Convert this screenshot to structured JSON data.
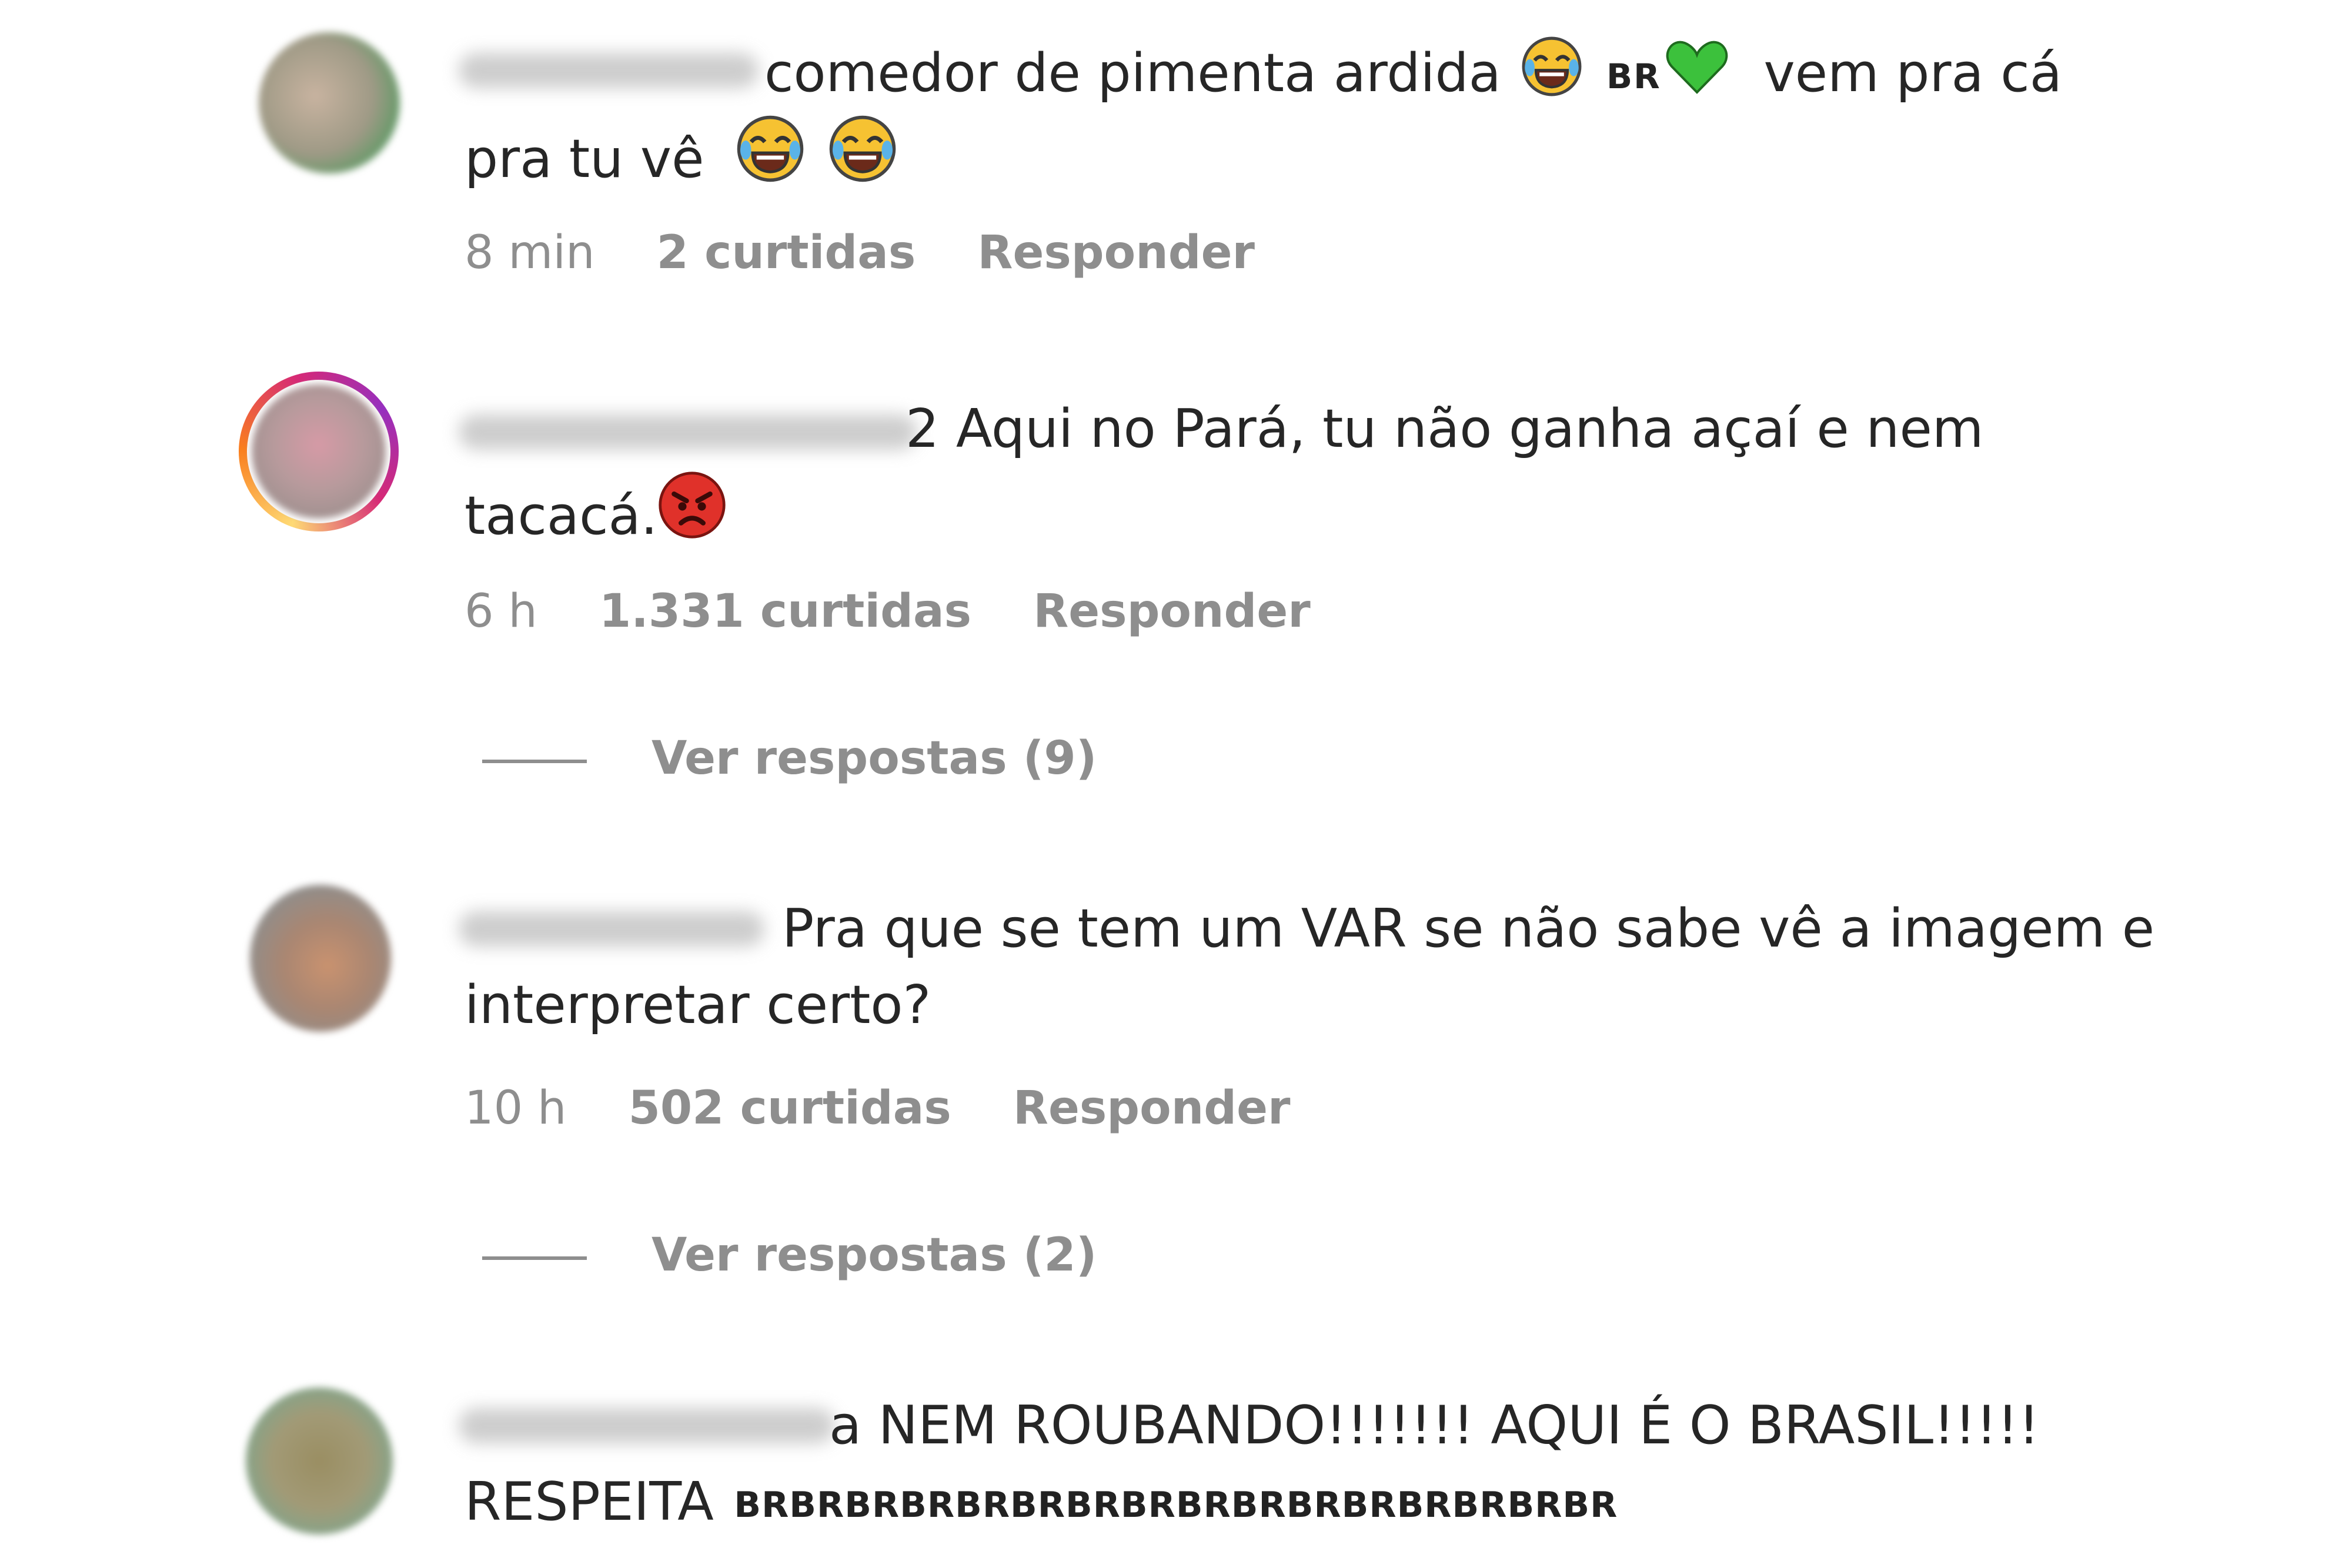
{
  "comments": [
    {
      "text_part1": "comedor de pimenta ardida",
      "flag": "BR",
      "text_part2": "vem pra cá",
      "text_line2": "pra tu vê",
      "time": "8 min",
      "likes": "2 curtidas",
      "reply": "Responder",
      "emoji": [
        "tears-of-joy-icon",
        "green-heart-icon"
      ]
    },
    {
      "text_part1": "2 Aqui no Pará, tu não ganha açaí e nem",
      "text_line2": "tacacá.",
      "time": "6 h",
      "likes": "1.331 curtidas",
      "reply": "Responder",
      "view_replies": "Ver respostas (9)",
      "emoji": [
        "angry-face-icon"
      ]
    },
    {
      "text_part1": "Pra que se tem um VAR se não sabe vê a imagem e",
      "text_line2": "interpretar certo?",
      "time": "10 h",
      "likes": "502 curtidas",
      "reply": "Responder",
      "view_replies": "Ver respostas (2)"
    },
    {
      "text_part1": "a NEM ROUBANDO!!!!!!! AQUI É O BRASIL!!!!!",
      "text_line2": "RESPEITA",
      "flags": "BRBRBRBRBRBRBRBRBRBRBRBRBRBRBRBR"
    }
  ],
  "colors": {
    "text": "#262626",
    "meta": "#8e8e8e",
    "green_heart": "#3cc13c",
    "angry": "#e0312a"
  }
}
